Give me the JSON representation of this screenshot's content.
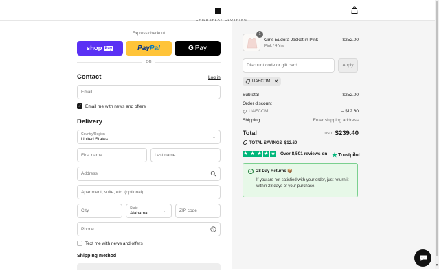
{
  "header": {
    "brand": "CHILDSPLAY CLOTHING"
  },
  "express": {
    "label": "Express checkout",
    "shop_label": "shop",
    "shop_tag": "Pay",
    "paypal_a": "Pay",
    "paypal_b": "Pal",
    "gpay_g": "G",
    "gpay_label": "Pay",
    "or": "OR"
  },
  "contact": {
    "title": "Contact",
    "login": "Log in",
    "email_placeholder": "Email",
    "news_label": "Email me with news and offers",
    "news_checked": true
  },
  "delivery": {
    "title": "Delivery",
    "country_label": "Country/Region",
    "country_value": "United States",
    "first_name": "First name",
    "last_name": "Last name",
    "address": "Address",
    "apartment": "Apartment, suite, etc. (optional)",
    "city": "City",
    "state_label": "State",
    "state_value": "Alabama",
    "zip": "ZIP code",
    "phone": "Phone",
    "text_label": "Text me with news and offers",
    "shipping_method": "Shipping method"
  },
  "summary": {
    "qty": "1",
    "product_name": "Girls Eudora Jacket in Pink",
    "product_variant": "Pink / 4 Yrs",
    "product_price": "$252.00",
    "discount_placeholder": "Discount code or gift card",
    "apply": "Apply",
    "code": "UAECOM",
    "subtotal_label": "Subtotal",
    "subtotal": "$252.00",
    "order_discount_label": "Order discount",
    "discount_code": "UAECOM",
    "discount_amount": "– $12.60",
    "shipping_label": "Shipping",
    "shipping_value": "Enter shipping address",
    "total_label": "Total",
    "currency": "USD",
    "total": "$239.40",
    "savings": "TOTAL SAVINGS  $12.60",
    "reviews": "Over 8,501 reviews on",
    "trustpilot": "Trustpilot",
    "returns_title": "28 Day Returns 📦",
    "returns_text": "If you are not satisfied with your order, just return it within 28 days of your purchase."
  },
  "colors": {
    "shop": "#5a31f4",
    "paypal": "#ffc439",
    "trustpilot": "#00b67a",
    "returns_bg": "#e7f8e8"
  }
}
